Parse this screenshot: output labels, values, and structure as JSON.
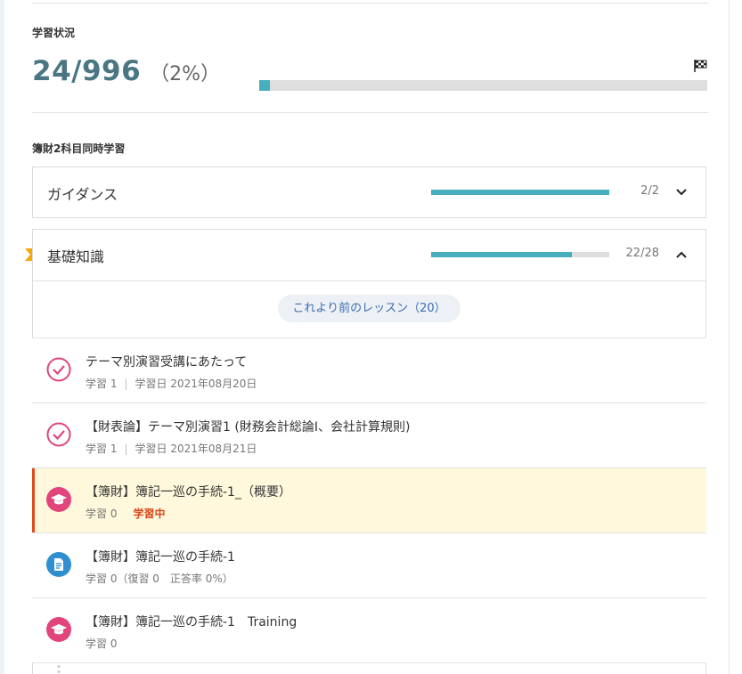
{
  "progress": {
    "label": "学習状況",
    "count": "24/996",
    "percent_text": "（2%）",
    "fraction": 0.024
  },
  "course": {
    "label": "簿財2科目同時学習",
    "sections": [
      {
        "title": "ガイダンス",
        "count": "2/2",
        "fraction": 1.0,
        "expanded": false
      },
      {
        "title": "基礎知識",
        "count": "22/28",
        "fraction": 0.79,
        "expanded": true
      }
    ],
    "prev_lessons_label": "これより前のレッスン（20）",
    "lessons": [
      {
        "title": "テーマ別演習受講にあたって",
        "meta_count": "学習 1",
        "meta_date": "学習日 2021年08月20日",
        "icon": "check-circle-icon"
      },
      {
        "title": "【財表論】テーマ別演習1 (財務会計総論Ⅰ、会社計算規則)",
        "meta_count": "学習 1",
        "meta_date": "学習日 2021年08月21日",
        "icon": "check-circle-icon"
      },
      {
        "title": "【簿財】簿記一巡の手続-1_（概要）",
        "meta_count": "学習 0",
        "status": "学習中",
        "icon": "graduation-cap-icon"
      },
      {
        "title": "【簿財】簿記一巡の手続-1",
        "meta_count": "学習 0（復習 0　正答率 0%）",
        "icon": "document-icon"
      },
      {
        "title": "【簿財】簿記一巡の手続-1　Training",
        "meta_count": "学習 0",
        "icon": "graduation-cap-icon"
      }
    ]
  },
  "colors": {
    "accent": "#46aebd",
    "stat": "#4a7684",
    "pink": "#e2457c",
    "blue": "#2f8fd1",
    "current_bg": "#fff8dc",
    "current_mark": "#e04a19"
  }
}
